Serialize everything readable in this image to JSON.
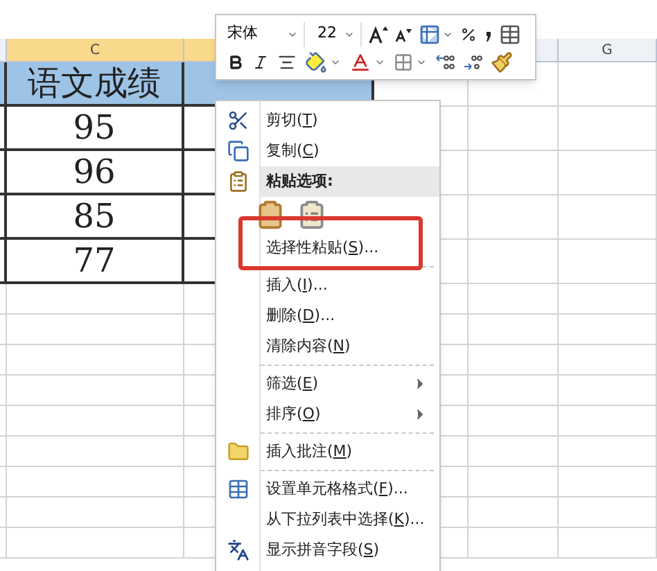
{
  "sheet": {
    "column_headers": [
      "C",
      "G"
    ],
    "header_cells": [
      "语文成绩"
    ],
    "values": [
      "95",
      "96",
      "85",
      "77"
    ]
  },
  "mini_toolbar": {
    "font": "宋体",
    "size": "22"
  },
  "context_menu": [
    {
      "kind": "item",
      "before": "剪切(",
      "key": "T",
      "after": ")",
      "submenu": false,
      "highlighted": false
    },
    {
      "kind": "item",
      "before": "复制(",
      "key": "C",
      "after": ")",
      "submenu": false,
      "highlighted": false
    },
    {
      "kind": "header",
      "text": "粘贴选项:"
    },
    {
      "kind": "paste_icons"
    },
    {
      "kind": "item",
      "before": "选择性粘贴(",
      "key": "S",
      "after": ")...",
      "submenu": false,
      "highlighted": true
    },
    {
      "kind": "separator"
    },
    {
      "kind": "item",
      "before": "插入(",
      "key": "I",
      "after": ")...",
      "submenu": false,
      "highlighted": false
    },
    {
      "kind": "item",
      "before": "删除(",
      "key": "D",
      "after": ")...",
      "submenu": false,
      "highlighted": false
    },
    {
      "kind": "item",
      "before": "清除内容(",
      "key": "N",
      "after": ")",
      "submenu": false,
      "highlighted": false
    },
    {
      "kind": "separator"
    },
    {
      "kind": "item",
      "before": "筛选(",
      "key": "E",
      "after": ")",
      "submenu": true,
      "highlighted": false
    },
    {
      "kind": "item",
      "before": "排序(",
      "key": "O",
      "after": ")",
      "submenu": true,
      "highlighted": false
    },
    {
      "kind": "separator"
    },
    {
      "kind": "item",
      "before": "插入批注(",
      "key": "M",
      "after": ")",
      "submenu": false,
      "highlighted": false
    },
    {
      "kind": "separator"
    },
    {
      "kind": "item",
      "before": "设置单元格格式(",
      "key": "F",
      "after": ")...",
      "submenu": false,
      "highlighted": false
    },
    {
      "kind": "item",
      "before": "从下拉列表中选择(",
      "key": "K",
      "after": ")...",
      "submenu": false,
      "highlighted": false
    },
    {
      "kind": "item",
      "before": "显示拼音字段(",
      "key": "S",
      "after": ")",
      "submenu": false,
      "highlighted": false
    }
  ]
}
